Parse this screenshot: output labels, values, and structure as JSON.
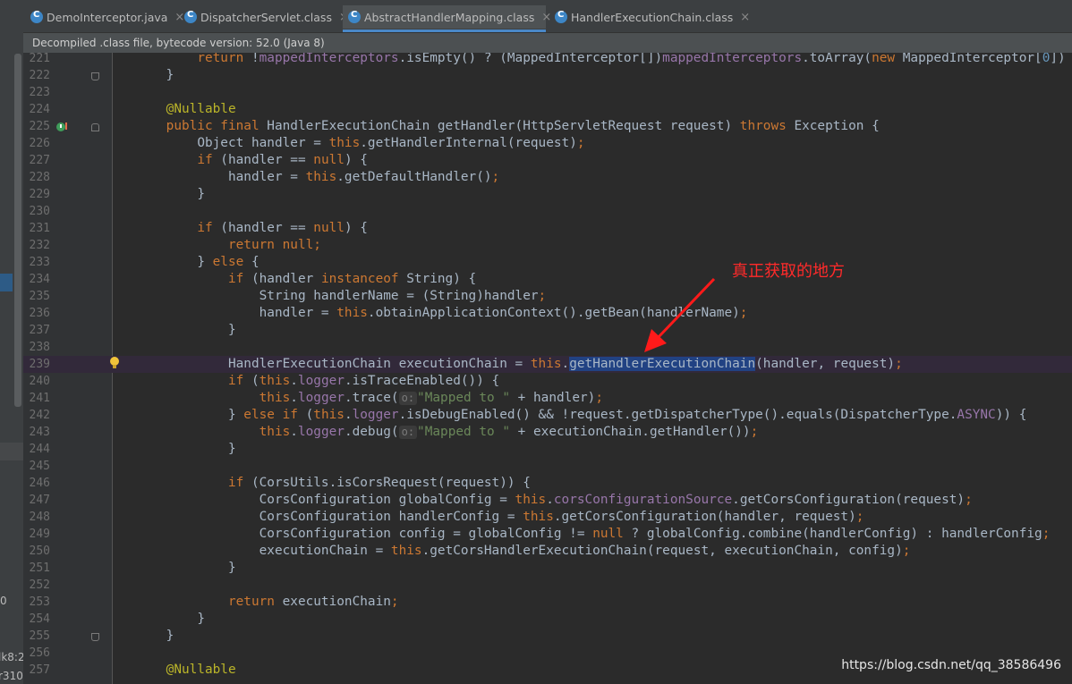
{
  "tabs": [
    {
      "label": "DemoInterceptor.java",
      "active": false
    },
    {
      "label": "DispatcherServlet.class",
      "active": false
    },
    {
      "label": "AbstractHandlerMapping.class",
      "active": true
    },
    {
      "label": "HandlerExecutionChain.class",
      "active": false
    }
  ],
  "info_bar": "Decompiled .class file, bytecode version: 52.0 (Java 8)",
  "left_panel": {
    "text_a": "0",
    "text_b": "lk8:2",
    "text_c": "r310"
  },
  "annotation": "真正获取的地方",
  "watermark": "https://blog.csdn.net/qq_38586496",
  "lines": [
    {
      "n": "221"
    },
    {
      "n": "222"
    },
    {
      "n": "223"
    },
    {
      "n": "224"
    },
    {
      "n": "225"
    },
    {
      "n": "226"
    },
    {
      "n": "227"
    },
    {
      "n": "228"
    },
    {
      "n": "229"
    },
    {
      "n": "230"
    },
    {
      "n": "231"
    },
    {
      "n": "232"
    },
    {
      "n": "233"
    },
    {
      "n": "234"
    },
    {
      "n": "235"
    },
    {
      "n": "236"
    },
    {
      "n": "237"
    },
    {
      "n": "238"
    },
    {
      "n": "239"
    },
    {
      "n": "240"
    },
    {
      "n": "241"
    },
    {
      "n": "242"
    },
    {
      "n": "243"
    },
    {
      "n": "244"
    },
    {
      "n": "245"
    },
    {
      "n": "246"
    },
    {
      "n": "247"
    },
    {
      "n": "248"
    },
    {
      "n": "249"
    },
    {
      "n": "250"
    },
    {
      "n": "251"
    },
    {
      "n": "252"
    },
    {
      "n": "253"
    },
    {
      "n": "254"
    },
    {
      "n": "255"
    },
    {
      "n": "256"
    },
    {
      "n": "257"
    }
  ],
  "code": {
    "l221": {
      "kw1": "return",
      "t1": " !",
      "f1": "mappedInterceptors",
      "t2": ".isEmpty() ? (MappedInterceptor[])",
      "f2": "mappedInterceptors",
      "t3": ".toArray(",
      "kw2": "new",
      "t4": " MappedInterceptor[",
      "num": "0",
      "t5": "])"
    },
    "l222": "}",
    "l224": "@Nullable",
    "l225": {
      "kw1": "public final",
      "t1": " HandlerExecutionChain getHandler(HttpServletRequest request) ",
      "kw2": "throws",
      "t2": " Exception {"
    },
    "l226": {
      "t1": "Object handler = ",
      "kw": "this",
      "t2": ".getHandlerInternal(request)",
      "semi": ";"
    },
    "l227": {
      "kw1": "if",
      "t1": " (handler == ",
      "kw2": "null",
      "t2": ") {"
    },
    "l228": {
      "t1": "handler = ",
      "kw": "this",
      "t2": ".getDefaultHandler()",
      "semi": ";"
    },
    "l229": "}",
    "l231": {
      "kw1": "if",
      "t1": " (handler == ",
      "kw2": "null",
      "t2": ") {"
    },
    "l232": {
      "kw": "return null",
      "semi": ";"
    },
    "l233": {
      "t1": "} ",
      "kw": "else",
      "t2": " {"
    },
    "l234": {
      "kw1": "if",
      "t1": " (handler ",
      "kw2": "instanceof",
      "t2": " String) {"
    },
    "l235": {
      "t1": "String handlerName = (String)handler",
      "semi": ";"
    },
    "l236": {
      "t1": "handler = ",
      "kw": "this",
      "t2": ".obtainApplicationContext().getBean(handlerName)",
      "semi": ";"
    },
    "l237": "}",
    "l239": {
      "t1": "HandlerExecutionChain executionChain = ",
      "kw": "this",
      "t2": ".",
      "sel": "getHandlerExecutionChain",
      "t3": "(handler, request)",
      "semi": ";"
    },
    "l240": {
      "kw1": "if",
      "t1": " (",
      "kw2": "this",
      "t2": ".",
      "f": "logger",
      "t3": ".isTraceEnabled()) {"
    },
    "l241": {
      "kw": "this",
      "t1": ".",
      "f": "logger",
      "t2": ".trace(",
      "hint": "o:",
      "str": "\"Mapped to \"",
      "t3": " + handler)",
      "semi": ";"
    },
    "l242": {
      "t1": "} ",
      "kw1": "else if",
      "t2": " (",
      "kw2": "this",
      "t3": ".",
      "f": "logger",
      "t4": ".isDebugEnabled() && !request.getDispatcherType().equals(DispatcherType.",
      "f2": "ASYNC",
      "t5": ")) {"
    },
    "l243": {
      "kw": "this",
      "t1": ".",
      "f": "logger",
      "t2": ".debug(",
      "hint": "o:",
      "str": "\"Mapped to \"",
      "t3": " + executionChain.getHandler())",
      "semi": ";"
    },
    "l244": "}",
    "l246": {
      "kw": "if",
      "t1": " (CorsUtils.isCorsRequest(request)) {"
    },
    "l247": {
      "t1": "CorsConfiguration globalConfig = ",
      "kw": "this",
      "t2": ".",
      "f": "corsConfigurationSource",
      "t3": ".getCorsConfiguration(request)",
      "semi": ";"
    },
    "l248": {
      "t1": "CorsConfiguration handlerConfig = ",
      "kw": "this",
      "t2": ".getCorsConfiguration(handler, request)",
      "semi": ";"
    },
    "l249": {
      "t1": "CorsConfiguration config = globalConfig != ",
      "kw": "null",
      "t2": " ? globalConfig.combine(handlerConfig) : handlerConfig",
      "semi": ";"
    },
    "l250": {
      "t1": "executionChain = ",
      "kw": "this",
      "t2": ".getCorsHandlerExecutionChain(request, executionChain, config)",
      "semi": ";"
    },
    "l251": "}",
    "l253": {
      "kw": "return",
      "t1": " executionChain",
      "semi": ";"
    },
    "l254": "}",
    "l255": "}",
    "l257": "@Nullable"
  }
}
